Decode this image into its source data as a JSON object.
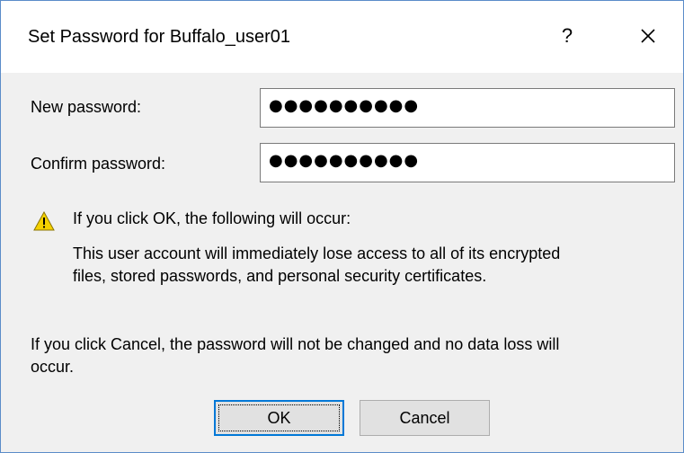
{
  "window": {
    "title": "Set Password for Buffalo_user01",
    "help_glyph": "?",
    "close_icon": "close-icon"
  },
  "form": {
    "new_password_label": "New password:",
    "new_password_value": "●●●●●●●●●●",
    "confirm_password_label": "Confirm password:",
    "confirm_password_value": "●●●●●●●●●●"
  },
  "warning": {
    "icon": "warning-icon",
    "icon_color": "#f5d100",
    "heading": "If you click OK, the following will occur:",
    "line1": "This user account will immediately lose access to all of its encrypted",
    "line2": "files, stored passwords, and personal security certificates."
  },
  "cancel_note": {
    "line1": "If you click Cancel, the password will not be changed and no data loss will",
    "line2": "occur."
  },
  "buttons": {
    "ok_label": "OK",
    "cancel_label": "Cancel"
  }
}
